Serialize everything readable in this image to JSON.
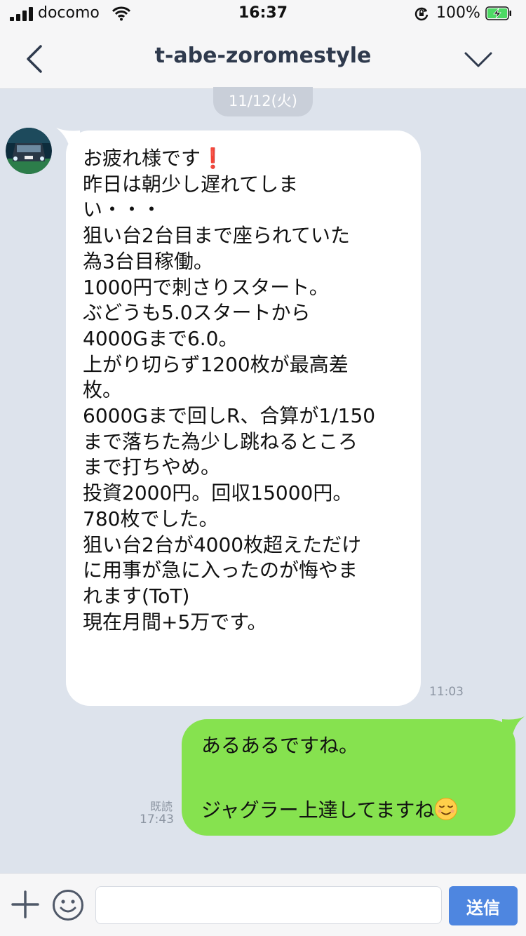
{
  "status_bar": {
    "carrier": "docomo",
    "time": "16:37",
    "battery_percent": "100%",
    "signal_bars": 4,
    "battery_level": 1.0,
    "icons": [
      "signal-icon",
      "wifi-icon",
      "orientation-lock-icon",
      "battery-charging-icon"
    ]
  },
  "header": {
    "title": "t-abe-zoromestyle",
    "back_icon": "chevron-left-icon",
    "menu_icon": "chevron-down-icon"
  },
  "date_separator": "11/12(火)",
  "messages": [
    {
      "direction": "incoming",
      "text": "お疲れ様です❗️\n昨日は朝少し遅れてしま\nい・・・\n狙い台2台目まで座られていた\n為3台目稼働。\n1000円で刺さりスタート。\nぶどうも5.0スタートから\n4000Gまで6.0。\n上がり切らず1200枚が最高差\n枚。\n6000Gまで回しR、合算が1/150\nまで落ちた為少し跳ねるところ\nまで打ちやめ。\n投資2000円。回収15000円。\n780枚でした。\n狙い台2台が4000枚超えただけ\nに用事が急に入ったのが悔やま\nれます(ToT)\n現在月間+5万です。",
      "time": "11:03"
    },
    {
      "direction": "outgoing",
      "line1": "あるあるですね。",
      "line2": "ジャグラー上達してますね",
      "emoji": "relieved-face-emoji",
      "read_label": "既読",
      "time": "17:43"
    }
  ],
  "input_bar": {
    "plus_icon": "plus-icon",
    "sticker_icon": "smiley-icon",
    "input_value": "",
    "send_label": "送信"
  },
  "colors": {
    "chat_background": "#dde3ec",
    "incoming_bubble": "#ffffff",
    "outgoing_bubble": "#86e24f",
    "send_button": "#4e86e0",
    "date_pill": "#c9cfd9"
  }
}
